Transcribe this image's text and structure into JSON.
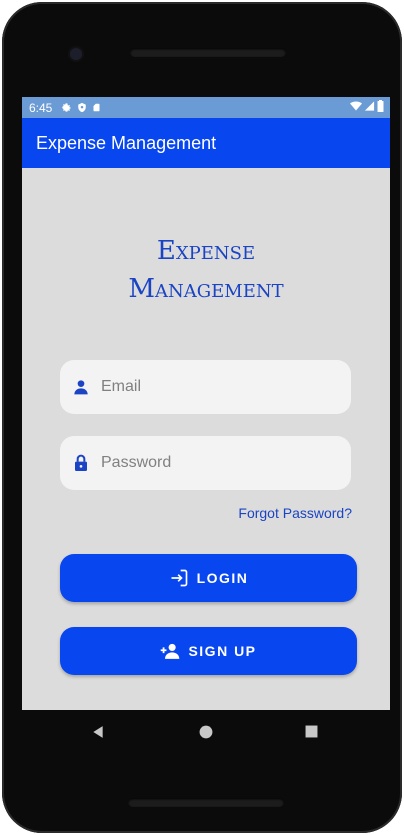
{
  "status_bar": {
    "time": "6:45",
    "left_icons": [
      "settings-icon",
      "shield-icon",
      "sd-card-icon"
    ],
    "right_icons": [
      "wifi-icon",
      "signal-icon",
      "battery-icon"
    ],
    "color": "#6a9bd4"
  },
  "app_bar": {
    "title": "Expense Management",
    "color": "#0846f0"
  },
  "brand": {
    "line1": "Expense",
    "line2": "Management"
  },
  "login_form": {
    "email_placeholder": "Email",
    "email_value": "",
    "email_icon": "person-icon",
    "password_placeholder": "Password",
    "password_value": "",
    "password_icon": "lock-icon",
    "forgot_password": "Forgot Password?",
    "login_label": "LOGIN",
    "login_icon": "login-icon",
    "signup_label": "SIGN UP",
    "signup_icon": "person-add-icon"
  },
  "nav_bar": {
    "buttons": [
      "back-icon",
      "home-icon",
      "recents-icon"
    ]
  }
}
